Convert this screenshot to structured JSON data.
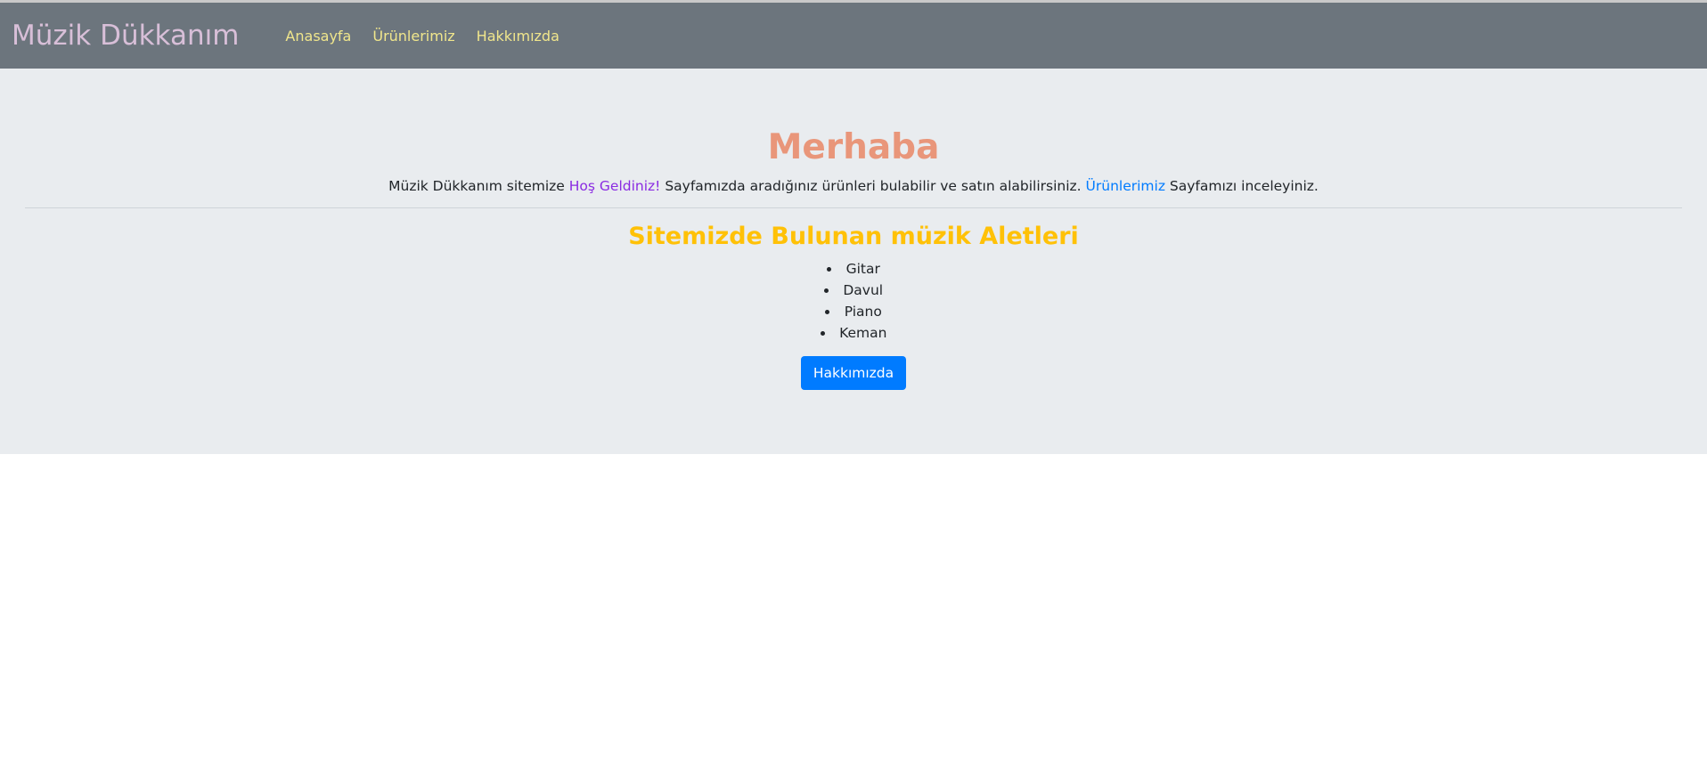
{
  "navbar": {
    "brand": "Müzik Dükkanım",
    "links": [
      "Anasayfa",
      "Ürünlerimiz",
      "Hakkımızda"
    ]
  },
  "hero": {
    "title": "Merhaba",
    "lead_part1": "Müzik Dükkanım sitemize ",
    "lead_highlight": "Hoş Geldiniz!",
    "lead_part2": " Sayfamızda aradığınız ürünleri bulabilir ve satın alabilirsiniz. ",
    "lead_link": "Ürünlerimiz",
    "lead_part3": " Sayfamızı inceleyiniz."
  },
  "instruments": {
    "heading": "Sitemizde Bulunan müzik Aletleri",
    "items": [
      "Gitar",
      "Davul",
      "Piano",
      "Keman"
    ]
  },
  "button": {
    "label": "Hakkımızda"
  },
  "colors": {
    "navbar_bg": "#6c757d",
    "brand": "#d8bfd8",
    "nav_link": "#f0e68c",
    "jumbotron_bg": "#e9ecef",
    "title": "#e9967a",
    "subheading": "#ffc107",
    "highlight": "#8a2be2",
    "link": "#007bff",
    "button_bg": "#007bff"
  }
}
